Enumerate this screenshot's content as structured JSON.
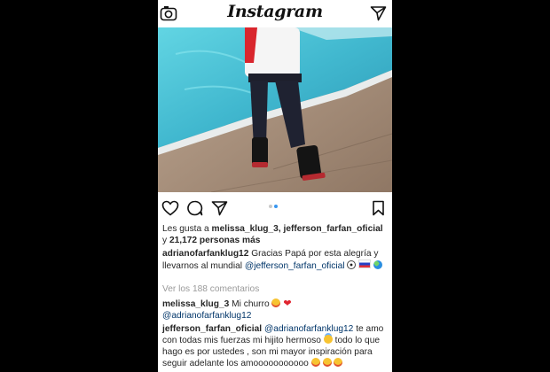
{
  "app": {
    "logo_text": "Instagram"
  },
  "post": {
    "likes": {
      "prefix": "Les gusta a",
      "users": "melissa_klug_3, jefferson_farfan_oficial",
      "join": "y",
      "count_text": "21,172 personas más"
    },
    "caption": {
      "username": "adrianofarfanklug12",
      "text": "Gracias Papá por esta alegría y llevarnos al mundial",
      "mention": "@jefferson_farfan_oficial"
    },
    "view_comments": "Ver los 188 comentarios",
    "carousel": {
      "count": 2,
      "active_index": 1
    },
    "comments": [
      {
        "username": "melissa_klug_3",
        "text": "Mi churro",
        "mention": "@adrianofarfanklug12"
      },
      {
        "username": "jefferson_farfan_oficial",
        "mention": "@adrianofarfanklug12",
        "text_a": "te amo con todas mis fuerzas mi hijito hermoso",
        "text_b": "todo lo que hago es  por ustedes , son mi mayor inspiración para seguir adelante los amooooooooooo"
      }
    ]
  },
  "icons": [
    "camera-icon",
    "send-icon",
    "heart-icon",
    "comment-icon",
    "share-icon",
    "bookmark-icon"
  ],
  "colors": {
    "link": "#003569",
    "muted": "#9a9a9a",
    "carousel_active": "#3897f0",
    "text": "#262626"
  }
}
